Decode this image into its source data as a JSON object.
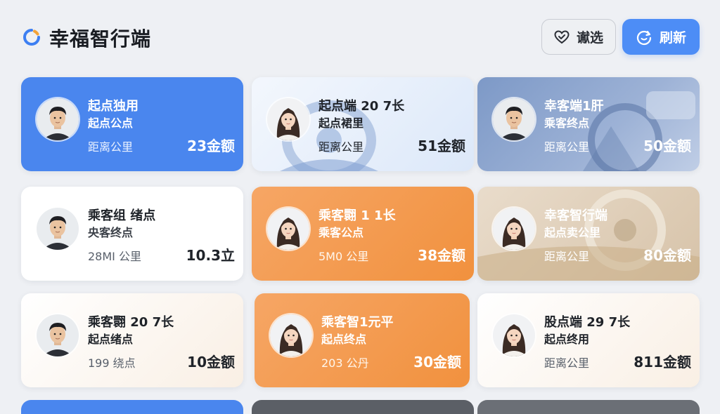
{
  "app": {
    "title": "幸福智行端"
  },
  "toolbar": {
    "filter_label": "谳选",
    "refresh_label": "刷新"
  },
  "cards": [
    {
      "line1": "起点独用",
      "line2": "起点公点",
      "line3": "距离公里",
      "amount": "23金额",
      "theme": "blue",
      "avatar": "male"
    },
    {
      "line1": "起点端 20 7长",
      "line2": "起点裙里",
      "line3": "距离公里",
      "amount": "51金额",
      "theme": "lightblue",
      "avatar": "female"
    },
    {
      "line1": "幸客端1肝",
      "line2": "乘客终点",
      "line3": "距离公里",
      "amount": "50金额",
      "theme": "blueimg",
      "avatar": "male"
    },
    {
      "line1": "乘客组 绪点",
      "line2": "央客终点",
      "line3": "28MI 公里",
      "amount": "10.3立",
      "theme": "white",
      "avatar": "male"
    },
    {
      "line1": "乘客翾 1 1长",
      "line2": "乘客公点",
      "line3": "5M0 公里",
      "amount": "38金额",
      "theme": "orange",
      "avatar": "female"
    },
    {
      "line1": "幸客智行端",
      "line2": "起点卖公里",
      "line3": "距离公里",
      "amount": "80金额",
      "theme": "beige",
      "avatar": "female"
    },
    {
      "line1": "乘客翾 20 7长",
      "line2": "起点绪点",
      "line3": "199 绕点",
      "amount": "10金额",
      "theme": "cream",
      "avatar": "male"
    },
    {
      "line1": "乘客智1元平",
      "line2": "起点终点",
      "line3": "203 公丹",
      "amount": "30金额",
      "theme": "orange",
      "avatar": "female"
    },
    {
      "line1": "股点端 29 7长",
      "line2": "起点终用",
      "line3": "距离公里",
      "amount": "811金额",
      "theme": "cream",
      "avatar": "female"
    }
  ],
  "colors": {
    "accent_blue": "#4a86ee",
    "accent_orange": "#f39a4d",
    "page_bg": "#eef0f4"
  },
  "icons": {
    "logo": "app-logo-icon",
    "filter": "filter-heart-icon",
    "refresh": "refresh-smile-icon"
  }
}
